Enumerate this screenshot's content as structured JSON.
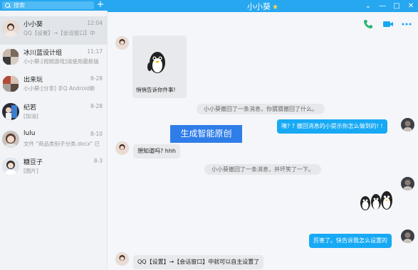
{
  "search": {
    "placeholder": "搜索",
    "add": "+"
  },
  "conversations": [
    {
      "name": "小小葵",
      "time": "12:04",
      "preview": "QQ【设置】→【会话窗口】中"
    },
    {
      "name": "冰川蓝设计组",
      "time": "11:17",
      "preview": "小小葵:[视频游戏]请使用最新版"
    },
    {
      "name": "出来玩",
      "time": "8-28",
      "preview": "小小葵:[分享] 手Q Android新"
    },
    {
      "name": "纪若",
      "time": "8-28",
      "preview": "[加油]"
    },
    {
      "name": "lulu",
      "time": "8-10",
      "preview": "文件 \"商品类别子分类.docx\" 已"
    },
    {
      "name": "糖豆子",
      "time": "8-3",
      "preview": "[图片]"
    }
  ],
  "chat": {
    "title": "小小葵",
    "window_buttons": {
      "menu": "⌄",
      "minimize": "—",
      "maximize": "□",
      "close": "✕"
    },
    "sticker_caption": "悄悄告诉你件事!",
    "sys1": "小小葵撤回了一条消息，你猜猜撤回了什么。",
    "out1": "噢? ? 撤回消息的小提示你怎么做到的! !",
    "watermark": "生成智能原创",
    "in1": "想知道吗? hhh",
    "sys2": "小小葵撤回了一条消息，并坏笑了一下。",
    "out2": "厉害了。快告诉我怎么设置的",
    "in2": "QQ【设置】→【会话窗口】中就可以自主设置了"
  },
  "colors": {
    "accent": "#26a7f0",
    "bubble_out": "#17a9f4",
    "call_icon": "#2bb673"
  }
}
